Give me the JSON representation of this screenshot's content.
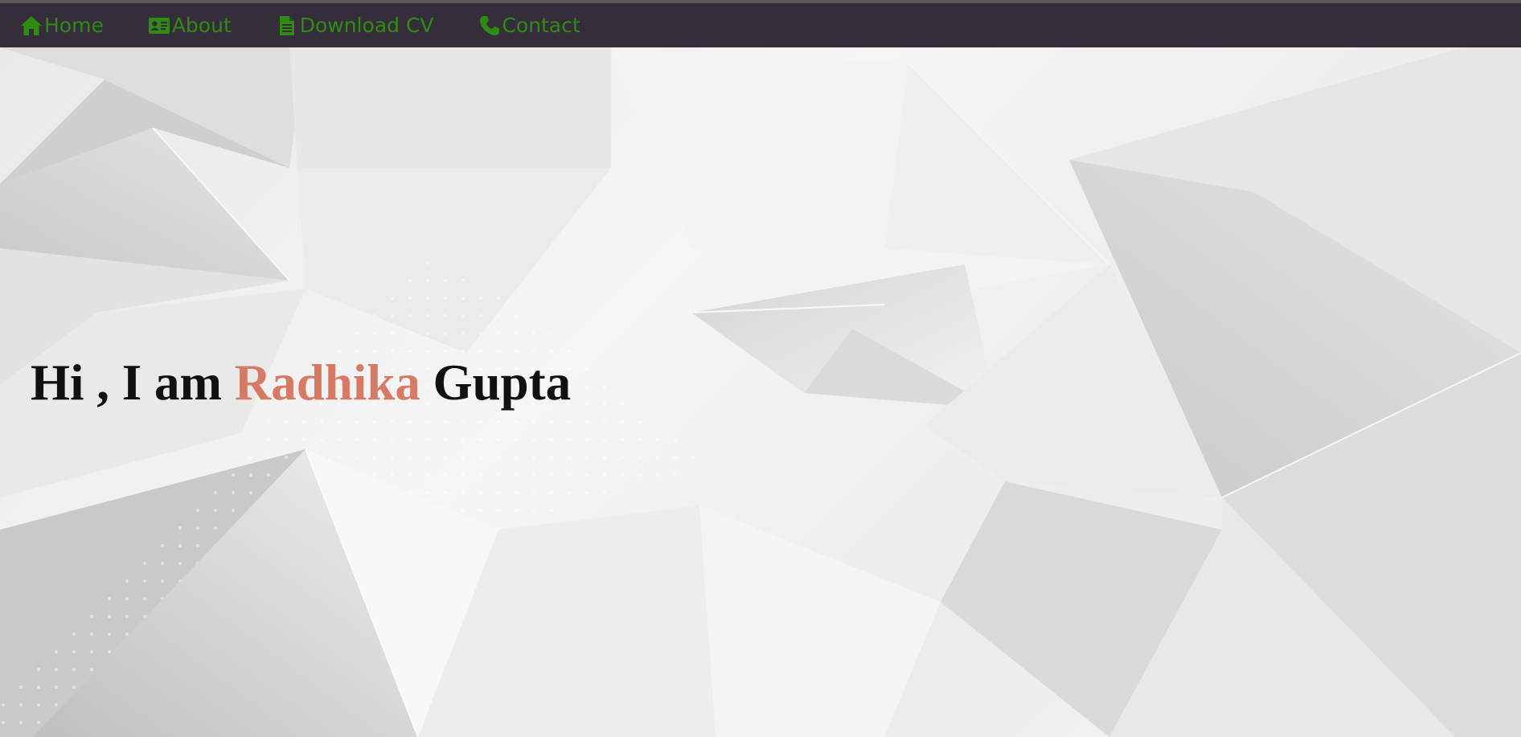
{
  "nav": {
    "items": [
      {
        "label": "Home",
        "icon": "home-icon"
      },
      {
        "label": "About",
        "icon": "id-card-icon"
      },
      {
        "label": "Download CV",
        "icon": "file-icon"
      },
      {
        "label": "Contact",
        "icon": "phone-icon"
      }
    ]
  },
  "hero": {
    "greeting": "Hi , I am",
    "first_name": "Radhika",
    "last_name": "Gupta"
  },
  "colors": {
    "navbar_bg": "#352d3a",
    "nav_link": "#2f8b14",
    "name_accent": "#d67a65",
    "heading_text": "#111111"
  }
}
